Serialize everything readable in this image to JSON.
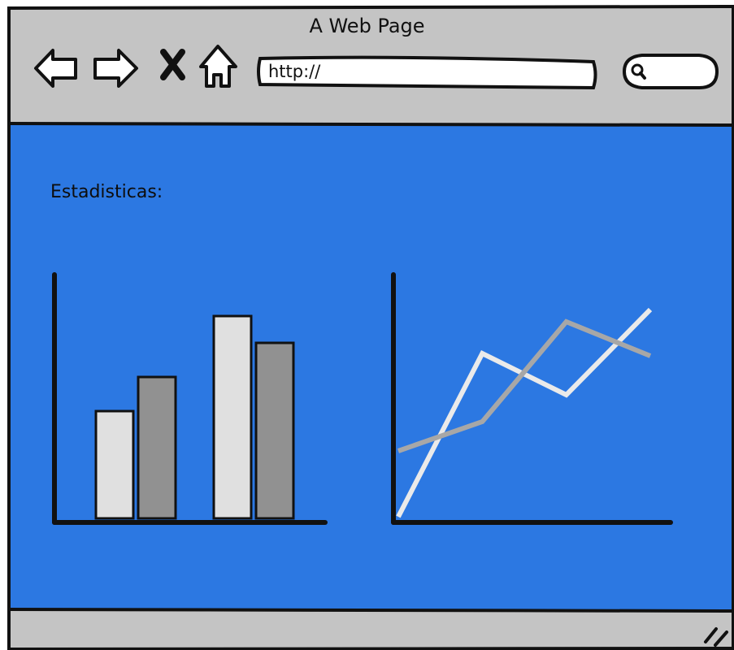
{
  "window": {
    "title": "A Web Page"
  },
  "toolbar": {
    "url": "http://",
    "icons": [
      "back-arrow-icon",
      "forward-arrow-icon",
      "close-x-icon",
      "home-icon",
      "search-icon"
    ]
  },
  "content": {
    "section_label": "Estadisticas:"
  },
  "chart_data": [
    {
      "type": "bar",
      "title": "",
      "categories": [
        "",
        ""
      ],
      "series": [
        {
          "color": "#e0e0e0",
          "values": [
            44,
            83
          ]
        },
        {
          "color": "#919191",
          "values": [
            58,
            72
          ]
        }
      ],
      "ylim": [
        0,
        100
      ],
      "grid": false
    },
    {
      "type": "line",
      "title": "",
      "x": [
        0,
        1,
        2,
        3
      ],
      "series": [
        {
          "color": "#eaeaea",
          "values": [
            0,
            67,
            50,
            85
          ]
        },
        {
          "color": "#a7a7a7",
          "values": [
            27,
            39,
            80,
            66
          ]
        }
      ],
      "ylim": [
        0,
        100
      ],
      "grid": false
    }
  ]
}
